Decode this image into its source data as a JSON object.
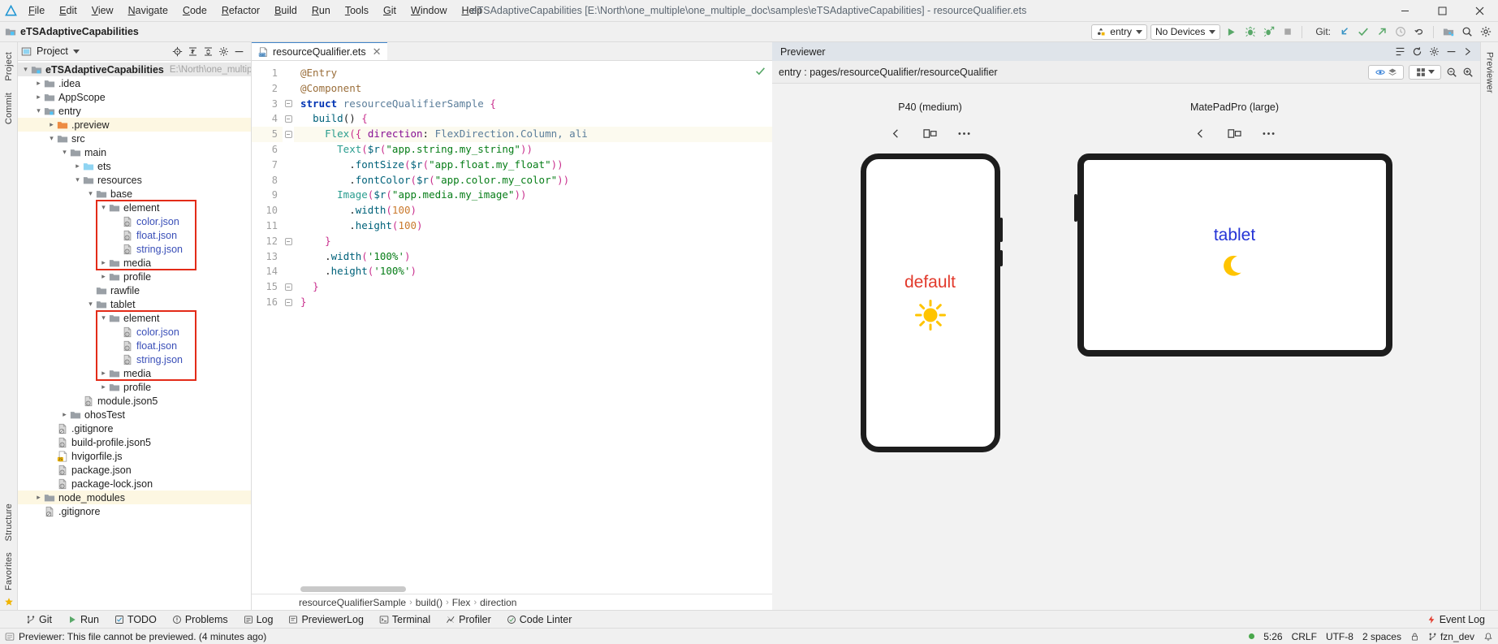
{
  "titlebar": {
    "logo_icon": "deveco-logo-icon",
    "window_title": "eTSAdaptiveCapabilities [E:\\North\\one_multiple\\one_multiple_doc\\samples\\eTSAdaptiveCapabilities] - resourceQualifier.ets",
    "menu": [
      {
        "label": "File",
        "mn": "F"
      },
      {
        "label": "Edit",
        "mn": "E"
      },
      {
        "label": "View",
        "mn": "V"
      },
      {
        "label": "Navigate",
        "mn": "N"
      },
      {
        "label": "Code",
        "mn": "C"
      },
      {
        "label": "Refactor",
        "mn": "R"
      },
      {
        "label": "Build",
        "mn": "B"
      },
      {
        "label": "Run",
        "mn": "R"
      },
      {
        "label": "Tools",
        "mn": "T"
      },
      {
        "label": "Git",
        "mn": "G"
      },
      {
        "label": "Window",
        "mn": "W"
      },
      {
        "label": "Help",
        "mn": "H"
      }
    ],
    "window_buttons": {
      "minimize": "minimize-icon",
      "maximize": "maximize-icon",
      "close": "close-icon"
    }
  },
  "navbar": {
    "breadcrumb": "eTSAdaptiveCapabilities",
    "run_config": "entry",
    "device_select": "No Devices",
    "git_label": "Git:",
    "actions": [
      "run-icon",
      "debug-icon",
      "profile-icon",
      "stop-icon"
    ],
    "git_actions": [
      "update-project-icon",
      "commit-icon",
      "push-icon",
      "history-icon",
      "rollback-icon"
    ],
    "right_actions": [
      "project-structure-icon",
      "search-icon",
      "settings-icon"
    ]
  },
  "left_rail": {
    "items": [
      "Project",
      "Commit",
      "Structure",
      "Favorites"
    ]
  },
  "right_rail": {
    "items": [
      "Previewer"
    ]
  },
  "project_panel": {
    "title": "Project",
    "header_icons": [
      "locate-icon",
      "expand-all-icon",
      "collapse-all-icon",
      "settings-icon",
      "hide-icon"
    ],
    "tree": [
      {
        "depth": 0,
        "label": "eTSAdaptiveCapabilities",
        "sub": "E:\\North\\one_multiple\\on",
        "icon": "module-folder-icon",
        "arrow": "down",
        "bold": true,
        "state": "rootsel"
      },
      {
        "depth": 1,
        "label": ".idea",
        "icon": "folder-icon",
        "arrow": "right"
      },
      {
        "depth": 1,
        "label": "AppScope",
        "icon": "folder-icon",
        "arrow": "right"
      },
      {
        "depth": 1,
        "label": "entry",
        "icon": "module-folder-icon",
        "arrow": "down"
      },
      {
        "depth": 2,
        "label": ".preview",
        "icon": "orange-folder-icon",
        "arrow": "right",
        "state": "sel"
      },
      {
        "depth": 2,
        "label": "src",
        "icon": "folder-icon",
        "arrow": "down"
      },
      {
        "depth": 3,
        "label": "main",
        "icon": "folder-icon",
        "arrow": "down"
      },
      {
        "depth": 4,
        "label": "ets",
        "icon": "blue-folder-icon",
        "arrow": "right"
      },
      {
        "depth": 4,
        "label": "resources",
        "icon": "folder-icon",
        "arrow": "down"
      },
      {
        "depth": 5,
        "label": "base",
        "icon": "folder-icon",
        "arrow": "down"
      },
      {
        "depth": 6,
        "label": "element",
        "icon": "folder-icon",
        "arrow": "down"
      },
      {
        "depth": 7,
        "label": "color.json",
        "icon": "json-file-icon",
        "kind": "json"
      },
      {
        "depth": 7,
        "label": "float.json",
        "icon": "json-file-icon",
        "kind": "json"
      },
      {
        "depth": 7,
        "label": "string.json",
        "icon": "json-file-icon",
        "kind": "json"
      },
      {
        "depth": 6,
        "label": "media",
        "icon": "folder-icon",
        "arrow": "right"
      },
      {
        "depth": 6,
        "label": "profile",
        "icon": "folder-icon",
        "arrow": "right"
      },
      {
        "depth": 5,
        "label": "rawfile",
        "icon": "folder-icon"
      },
      {
        "depth": 5,
        "label": "tablet",
        "icon": "folder-icon",
        "arrow": "down"
      },
      {
        "depth": 6,
        "label": "element",
        "icon": "folder-icon",
        "arrow": "down"
      },
      {
        "depth": 7,
        "label": "color.json",
        "icon": "json-file-icon",
        "kind": "json"
      },
      {
        "depth": 7,
        "label": "float.json",
        "icon": "json-file-icon",
        "kind": "json"
      },
      {
        "depth": 7,
        "label": "string.json",
        "icon": "json-file-icon",
        "kind": "json"
      },
      {
        "depth": 6,
        "label": "media",
        "icon": "folder-icon",
        "arrow": "right"
      },
      {
        "depth": 6,
        "label": "profile",
        "icon": "folder-icon",
        "arrow": "right"
      },
      {
        "depth": 4,
        "label": "module.json5",
        "icon": "json5-file-icon"
      },
      {
        "depth": 3,
        "label": "ohosTest",
        "icon": "folder-icon",
        "arrow": "right"
      },
      {
        "depth": 2,
        "label": ".gitignore",
        "icon": "gitignore-file-icon"
      },
      {
        "depth": 2,
        "label": "build-profile.json5",
        "icon": "json5-file-icon"
      },
      {
        "depth": 2,
        "label": "hvigorfile.js",
        "icon": "js-file-icon"
      },
      {
        "depth": 2,
        "label": "package.json",
        "icon": "json-file-icon"
      },
      {
        "depth": 2,
        "label": "package-lock.json",
        "icon": "json-file-icon"
      },
      {
        "depth": 1,
        "label": "node_modules",
        "icon": "folder-icon",
        "arrow": "right",
        "state": "sel"
      },
      {
        "depth": 1,
        "label": ".gitignore",
        "icon": "gitignore-file-icon"
      }
    ]
  },
  "editor": {
    "tab": {
      "label": "resourceQualifier.ets",
      "icon": "ets-file-icon",
      "close": "close-icon"
    },
    "inspection_status": "check-icon",
    "lines": [
      {
        "n": 1,
        "tokens": [
          {
            "t": "@Entry",
            "c": "ann"
          }
        ]
      },
      {
        "n": 2,
        "tokens": [
          {
            "t": "@Component",
            "c": "ann"
          }
        ]
      },
      {
        "n": 3,
        "fold": true,
        "tokens": [
          {
            "t": "struct ",
            "c": "kw"
          },
          {
            "t": "resourceQualifierSample ",
            "c": "id"
          },
          {
            "t": "{",
            "c": "brace"
          }
        ]
      },
      {
        "n": 4,
        "fold": true,
        "indent": 1,
        "tokens": [
          {
            "t": "build",
            "c": "fn"
          },
          {
            "t": "() ",
            "c": "plain"
          },
          {
            "t": "{",
            "c": "brace"
          }
        ]
      },
      {
        "n": 5,
        "fold": true,
        "indent": 2,
        "current": true,
        "tokens": [
          {
            "t": "Flex",
            "c": "type"
          },
          {
            "t": "(",
            "c": "brace"
          },
          {
            "t": "{ ",
            "c": "brace"
          },
          {
            "t": "direction",
            "c": "prop"
          },
          {
            "t": ": ",
            "c": "plain"
          },
          {
            "t": "FlexDirection.Column, ali",
            "c": "id"
          }
        ]
      },
      {
        "n": 6,
        "indent": 3,
        "tokens": [
          {
            "t": "Text",
            "c": "type"
          },
          {
            "t": "(",
            "c": "brace"
          },
          {
            "t": "$r",
            "c": "fn"
          },
          {
            "t": "(",
            "c": "brace"
          },
          {
            "t": "\"app.string.my_string\"",
            "c": "str"
          },
          {
            "t": "))",
            "c": "brace"
          }
        ]
      },
      {
        "n": 7,
        "indent": 4,
        "tokens": [
          {
            "t": ".",
            "c": "plain"
          },
          {
            "t": "fontSize",
            "c": "fn"
          },
          {
            "t": "(",
            "c": "brace"
          },
          {
            "t": "$r",
            "c": "fn"
          },
          {
            "t": "(",
            "c": "brace"
          },
          {
            "t": "\"app.float.my_float\"",
            "c": "str"
          },
          {
            "t": "))",
            "c": "brace"
          }
        ]
      },
      {
        "n": 8,
        "indent": 4,
        "tokens": [
          {
            "t": ".",
            "c": "plain"
          },
          {
            "t": "fontColor",
            "c": "fn"
          },
          {
            "t": "(",
            "c": "brace"
          },
          {
            "t": "$r",
            "c": "fn"
          },
          {
            "t": "(",
            "c": "brace"
          },
          {
            "t": "\"app.color.my_color\"",
            "c": "str"
          },
          {
            "t": "))",
            "c": "brace"
          }
        ]
      },
      {
        "n": 9,
        "indent": 3,
        "tokens": [
          {
            "t": "Image",
            "c": "type"
          },
          {
            "t": "(",
            "c": "brace"
          },
          {
            "t": "$r",
            "c": "fn"
          },
          {
            "t": "(",
            "c": "brace"
          },
          {
            "t": "\"app.media.my_image\"",
            "c": "str"
          },
          {
            "t": "))",
            "c": "brace"
          }
        ]
      },
      {
        "n": 10,
        "indent": 4,
        "tokens": [
          {
            "t": ".",
            "c": "plain"
          },
          {
            "t": "width",
            "c": "fn"
          },
          {
            "t": "(",
            "c": "brace"
          },
          {
            "t": "100",
            "c": "num"
          },
          {
            "t": ")",
            "c": "brace"
          }
        ]
      },
      {
        "n": 11,
        "indent": 4,
        "tokens": [
          {
            "t": ".",
            "c": "plain"
          },
          {
            "t": "height",
            "c": "fn"
          },
          {
            "t": "(",
            "c": "brace"
          },
          {
            "t": "100",
            "c": "num"
          },
          {
            "t": ")",
            "c": "brace"
          }
        ]
      },
      {
        "n": 12,
        "fold": true,
        "indent": 2,
        "tokens": [
          {
            "t": "}",
            "c": "brace"
          }
        ]
      },
      {
        "n": 13,
        "indent": 2,
        "tokens": [
          {
            "t": ".",
            "c": "plain"
          },
          {
            "t": "width",
            "c": "fn"
          },
          {
            "t": "(",
            "c": "brace"
          },
          {
            "t": "'100%'",
            "c": "str"
          },
          {
            "t": ")",
            "c": "brace"
          }
        ]
      },
      {
        "n": 14,
        "indent": 2,
        "tokens": [
          {
            "t": ".",
            "c": "plain"
          },
          {
            "t": "height",
            "c": "fn"
          },
          {
            "t": "(",
            "c": "brace"
          },
          {
            "t": "'100%'",
            "c": "str"
          },
          {
            "t": ")",
            "c": "brace"
          }
        ]
      },
      {
        "n": 15,
        "fold": true,
        "indent": 1,
        "tokens": [
          {
            "t": "}",
            "c": "brace"
          }
        ]
      },
      {
        "n": 16,
        "fold": true,
        "tokens": [
          {
            "t": "}",
            "c": "brace"
          }
        ]
      }
    ],
    "breadcrumb": [
      "resourceQualifierSample",
      "build()",
      "Flex",
      "direction"
    ]
  },
  "previewer": {
    "title": "Previewer",
    "header_icons": [
      "layout-icon",
      "refresh-icon",
      "settings-icon",
      "minimize-icon",
      "hide-icon"
    ],
    "route": "entry : pages/resourceQualifier/resourceQualifier",
    "toolbar_icons": [
      "inspector-icon",
      "layers-icon",
      "grid-icon",
      "chevron-down-icon",
      "zoom-out-icon",
      "zoom-in-icon"
    ],
    "devices": [
      {
        "name": "P40 (medium)",
        "type": "phone",
        "controls": [
          "rotate-icon",
          "multi-window-icon",
          "more-icon"
        ],
        "content_text": "default",
        "content_color": "#e2392b",
        "content_icon": "sun-icon"
      },
      {
        "name": "MatePadPro (large)",
        "type": "tablet",
        "controls": [
          "rotate-icon",
          "multi-window-icon",
          "more-icon"
        ],
        "content_text": "tablet",
        "content_color": "#2433d6",
        "content_icon": "moon-icon"
      }
    ]
  },
  "tool_window_bar": {
    "items": [
      {
        "label": "Git",
        "icon": "git-icon"
      },
      {
        "label": "Run",
        "icon": "run-icon"
      },
      {
        "label": "TODO",
        "icon": "todo-icon"
      },
      {
        "label": "Problems",
        "icon": "problems-icon"
      },
      {
        "label": "Log",
        "icon": "log-icon"
      },
      {
        "label": "PreviewerLog",
        "icon": "previewer-log-icon"
      },
      {
        "label": "Terminal",
        "icon": "terminal-icon"
      },
      {
        "label": "Profiler",
        "icon": "profiler-icon"
      },
      {
        "label": "Code Linter",
        "icon": "code-linter-icon"
      }
    ],
    "event_log": {
      "label": "Event Log",
      "icon": "event-log-icon"
    }
  },
  "statusbar": {
    "message": "Previewer: This file cannot be previewed. (4 minutes ago)",
    "message_icon": "info-icon",
    "caret_position": "5:26",
    "line_separator": "CRLF",
    "encoding": "UTF-8",
    "indent": "2 spaces",
    "branch": "fzn_dev",
    "branch_icon": "branch-icon",
    "lock_icon": "lock-icon",
    "status_dot_color": "#49a84b"
  }
}
